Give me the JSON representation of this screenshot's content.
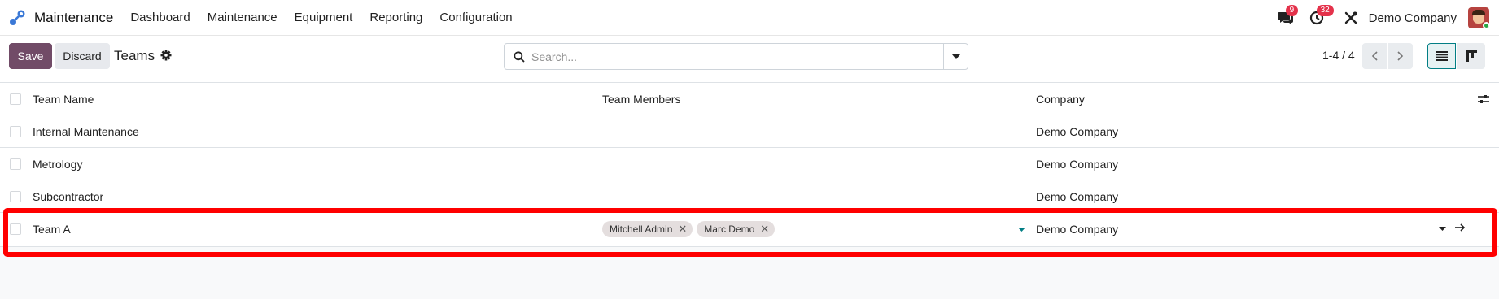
{
  "navbar": {
    "app_name": "Maintenance",
    "menu": [
      "Dashboard",
      "Maintenance",
      "Equipment",
      "Reporting",
      "Configuration"
    ],
    "messages_count": "9",
    "activities_count": "32",
    "company": "Demo Company",
    "icons": [
      "apps-logo-icon",
      "chat-icon",
      "clock-icon",
      "tools-icon"
    ]
  },
  "control": {
    "save_label": "Save",
    "discard_label": "Discard",
    "breadcrumb": "Teams",
    "search_placeholder": "Search...",
    "pager": "1-4 / 4"
  },
  "list": {
    "columns": [
      "Team Name",
      "Team Members",
      "Company"
    ],
    "rows": [
      {
        "name": "Internal Maintenance",
        "members": [],
        "company": "Demo Company"
      },
      {
        "name": "Metrology",
        "members": [],
        "company": "Demo Company"
      },
      {
        "name": "Subcontractor",
        "members": [],
        "company": "Demo Company"
      }
    ],
    "editing_row": {
      "name": "Team A",
      "members": [
        "Mitchell Admin",
        "Marc Demo"
      ],
      "company": "Demo Company"
    }
  },
  "colors": {
    "primary": "#714b67",
    "highlight": "#ff0000",
    "badge": "#e4324b"
  }
}
